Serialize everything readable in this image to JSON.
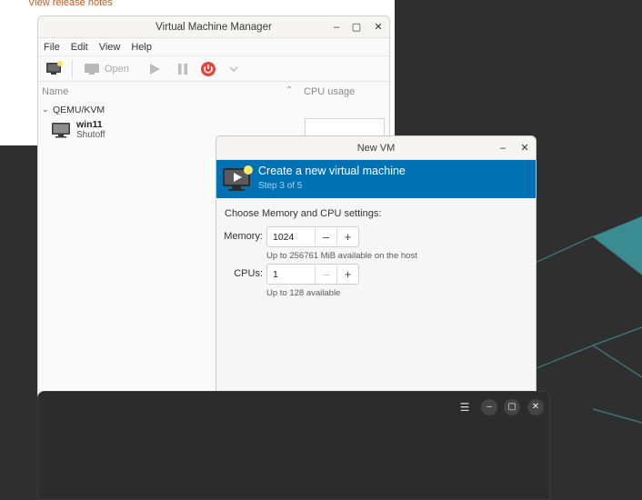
{
  "background_window": {
    "release_link": "View release notes"
  },
  "vmm": {
    "title": "Virtual Machine Manager",
    "window_controls": {
      "minimize": "–",
      "maximize": "▢",
      "close": "✕"
    },
    "menu": [
      "File",
      "Edit",
      "View",
      "Help"
    ],
    "toolbar": {
      "open_label": "Open"
    },
    "columns": {
      "name": "Name",
      "sort_indicator": "⌃",
      "cpu": "CPU usage"
    },
    "group": {
      "chevron": "⌄",
      "label": "QEMU/KVM"
    },
    "vms": [
      {
        "name": "win11",
        "state": "Shutoff"
      }
    ]
  },
  "newvm": {
    "title": "New VM",
    "window_controls": {
      "minimize": "–",
      "close": "✕"
    },
    "banner_title": "Create a new virtual machine",
    "step": "Step 3 of 5",
    "section_title": "Choose Memory and CPU settings:",
    "memory": {
      "label": "Memory:",
      "value": "1024",
      "hint": "Up to 256761 MiB available on the host"
    },
    "cpus": {
      "label": "CPUs:",
      "value": "1",
      "hint": "Up to 128 available"
    },
    "spin_minus": "–",
    "spin_plus": "+"
  },
  "dark_window": {
    "menu_icon": "☰",
    "minimize": "–",
    "maximize": "▢",
    "close": "✕"
  },
  "colors": {
    "banner": "#0072b3",
    "accent_link": "#c35a24",
    "power": "#e0463c",
    "desktop": "#2f2f2f",
    "hex_teal": "#3a8c92"
  }
}
